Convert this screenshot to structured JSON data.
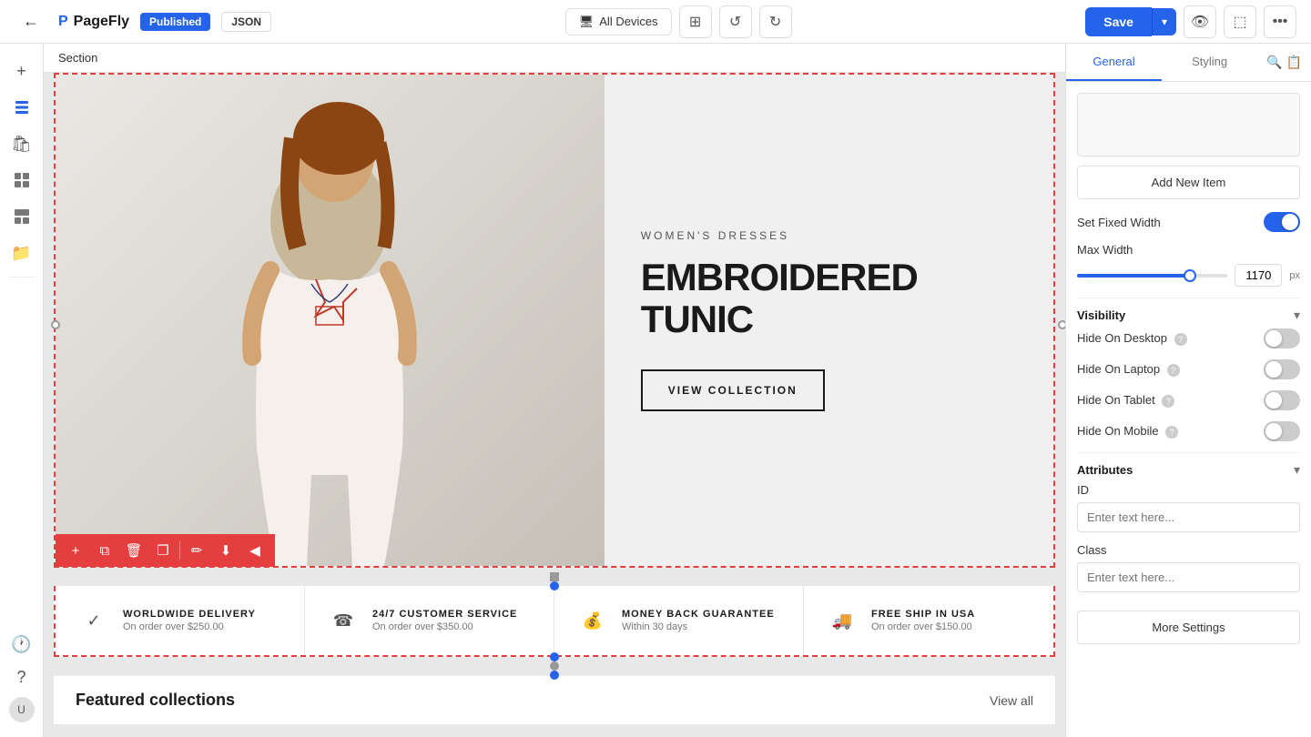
{
  "app": {
    "name": "PageFly",
    "status_published": "Published",
    "status_json": "JSON"
  },
  "topbar": {
    "back_icon": "←",
    "devices_label": "All Devices",
    "save_label": "Save",
    "save_dropdown_icon": "▾",
    "undo_icon": "↺",
    "redo_icon": "↻",
    "preview_icon": "👁",
    "share_icon": "⬚",
    "more_icon": "•••"
  },
  "section_label": "Section",
  "left_sidebar": {
    "icons": [
      {
        "name": "add-page-icon",
        "symbol": "+"
      },
      {
        "name": "layers-icon",
        "symbol": "⊞"
      },
      {
        "name": "shop-icon",
        "symbol": "🛍"
      },
      {
        "name": "elements-icon",
        "symbol": "⊟"
      },
      {
        "name": "sections-icon",
        "symbol": "⊡"
      },
      {
        "name": "folder-icon",
        "symbol": "📁"
      }
    ],
    "bottom_icons": [
      {
        "name": "history-icon",
        "symbol": "🕐"
      },
      {
        "name": "help-icon",
        "symbol": "?"
      },
      {
        "name": "user-icon",
        "symbol": "👤"
      }
    ]
  },
  "hero": {
    "category": "WOMEN'S DRESSES",
    "title": "EMBROIDERED TUNIC",
    "button_label": "VIEW COLLECTION"
  },
  "features": [
    {
      "icon": "✓",
      "title": "WORLDWIDE DELIVERY",
      "subtitle": "On order over $250.00"
    },
    {
      "icon": "☎",
      "title": "24/7 CUSTOMER SERVICE",
      "subtitle": "On order over $350.00"
    },
    {
      "icon": "💰",
      "title": "MONEY BACK GUARANTEE",
      "subtitle": "Within 30 days"
    },
    {
      "icon": "🚚",
      "title": "FREE SHIP IN USA",
      "subtitle": "On order over $150.00"
    }
  ],
  "featured": {
    "label": "Featured collections",
    "view_all": "View all"
  },
  "right_panel": {
    "tab_general": "General",
    "tab_styling": "Styling",
    "search_icon": "🔍",
    "clipboard_icon": "📋",
    "add_new_item_label": "Add New Item",
    "set_fixed_width_label": "Set Fixed Width",
    "max_width_label": "Max Width",
    "max_width_value": "1170",
    "max_width_unit": "px",
    "slider_percent": 75,
    "visibility_label": "Visibility",
    "hide_desktop_label": "Hide On Desktop",
    "hide_laptop_label": "Hide On Laptop",
    "hide_tablet_label": "Hide On Tablet",
    "hide_mobile_label": "Hide On Mobile",
    "attributes_label": "Attributes",
    "id_label": "ID",
    "id_placeholder": "Enter text here...",
    "class_label": "Class",
    "class_placeholder": "Enter text here...",
    "more_settings_label": "More Settings"
  },
  "colors": {
    "brand_blue": "#2563eb",
    "brand_red": "#e53e3e",
    "text_dark": "#1a1a1a"
  }
}
